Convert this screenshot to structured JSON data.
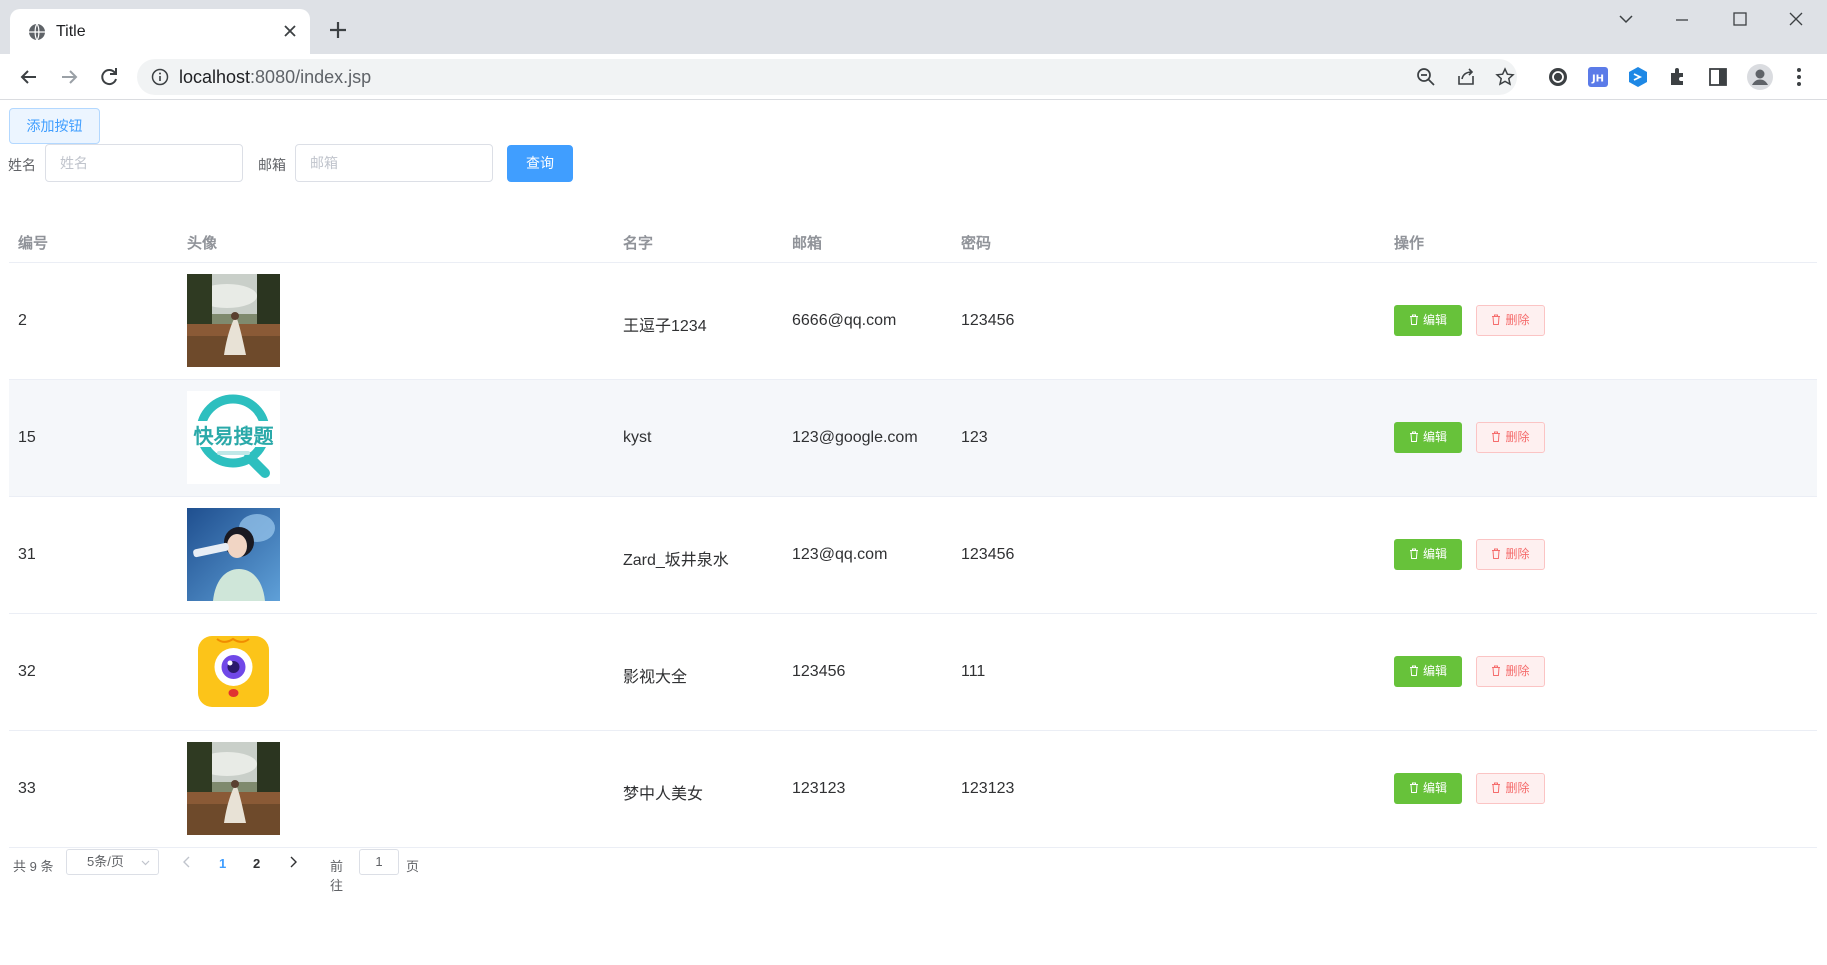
{
  "browser": {
    "tab_title": "Title",
    "url_host": "localhost",
    "url_rest": ":8080/index.jsp",
    "accent_color": "#1a73e8"
  },
  "toolbar": {
    "add_button_label": "添加按钮",
    "name_label": "姓名",
    "name_placeholder": "姓名",
    "email_label": "邮箱",
    "email_placeholder": "邮箱",
    "query_button_label": "查询"
  },
  "table": {
    "columns": [
      "编号",
      "头像",
      "名字",
      "邮箱",
      "密码",
      "操作"
    ],
    "rows": [
      {
        "id": "2",
        "avatar": "landscape-photo",
        "name": "王逗子1234",
        "email": "6666@qq.com",
        "password": "123456"
      },
      {
        "id": "15",
        "avatar": "kuaiyi-sousuo-logo",
        "name": "kyst",
        "email": "123@google.com",
        "password": "123"
      },
      {
        "id": "31",
        "avatar": "singer-photo",
        "name": "Zard_坂井泉水",
        "email": "123@qq.com",
        "password": "123456"
      },
      {
        "id": "32",
        "avatar": "yellow-eye-app-icon",
        "name": "影视大全",
        "email": "123456",
        "password": "111"
      },
      {
        "id": "33",
        "avatar": "landscape-photo",
        "name": "梦中人美女",
        "email": "123123",
        "password": "123123"
      }
    ],
    "edit_label": "编辑",
    "delete_label": "删除",
    "avatar_logo_text": "快易搜题"
  },
  "pagination": {
    "total_text": "共 9 条",
    "page_size": "5条/页",
    "pages": [
      "1",
      "2"
    ],
    "current_page": "1",
    "goto_label": "前往",
    "goto_value": "1",
    "page_unit": "页"
  },
  "colors": {
    "primary": "#409eff",
    "success": "#67c23a",
    "danger": "#f56c6c"
  }
}
